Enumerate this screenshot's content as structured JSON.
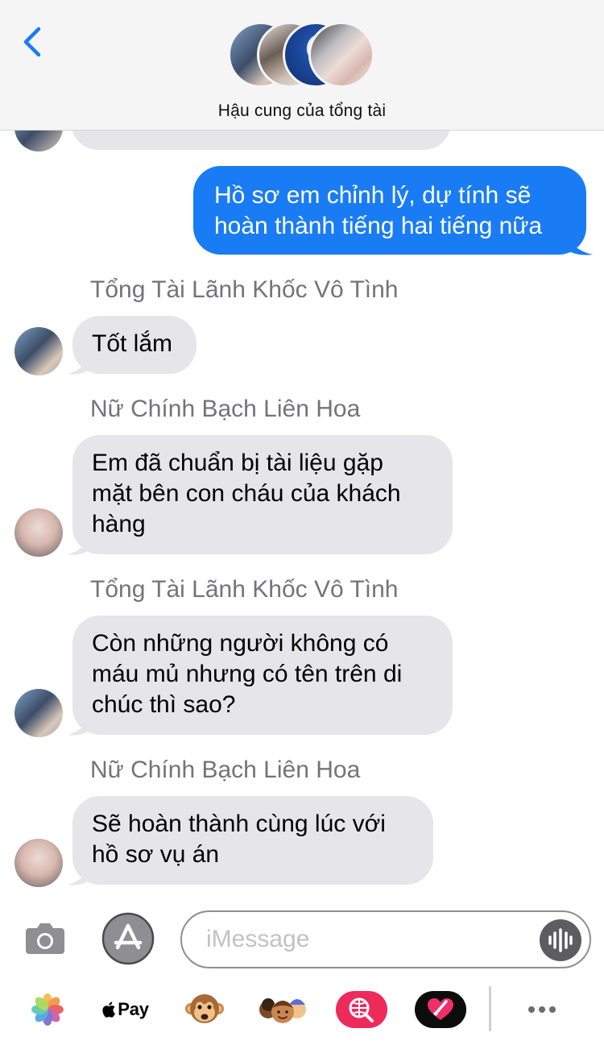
{
  "header": {
    "group_name": "Hậu cung của tổng tài",
    "back_icon": "chevron-left-icon"
  },
  "messages": [
    {
      "direction": "outgoing",
      "text": "Hồ sơ em chỉnh lý, dự tính sẽ\nhoàn thành tiếng hai tiếng nữa"
    },
    {
      "direction": "incoming",
      "sender": "Tổng Tài Lãnh Khốc Vô Tình",
      "text": "Tốt lắm"
    },
    {
      "direction": "incoming",
      "sender": "Nữ Chính Bạch Liên Hoa",
      "text": "Em đã chuẩn bị tài liệu gặp\nmặt bên con cháu của khách\nhàng"
    },
    {
      "direction": "incoming",
      "sender": "Tổng Tài Lãnh Khốc Vô Tình",
      "text": "Còn những người không có\nmáu mủ nhưng có tên trên di\nchúc thì sao?"
    },
    {
      "direction": "incoming",
      "sender": "Nữ Chính Bạch Liên Hoa",
      "text": "Sẽ hoàn thành cùng lúc với\nhồ sơ vụ án"
    }
  ],
  "composer": {
    "placeholder": "iMessage",
    "value": ""
  },
  "app_drawer": {
    "apple_pay_label": "Pay",
    "apps": [
      "photos-icon",
      "apple-pay-icon",
      "animoji-monkey-icon",
      "memoji-icon",
      "web-search-icon",
      "digital-touch-icon",
      "more-icon"
    ]
  },
  "colors": {
    "outgoing_bubble": "#1a7cf5",
    "incoming_bubble": "#e5e5ea",
    "accent": "#1a7cf5",
    "sender_name": "#747478"
  }
}
